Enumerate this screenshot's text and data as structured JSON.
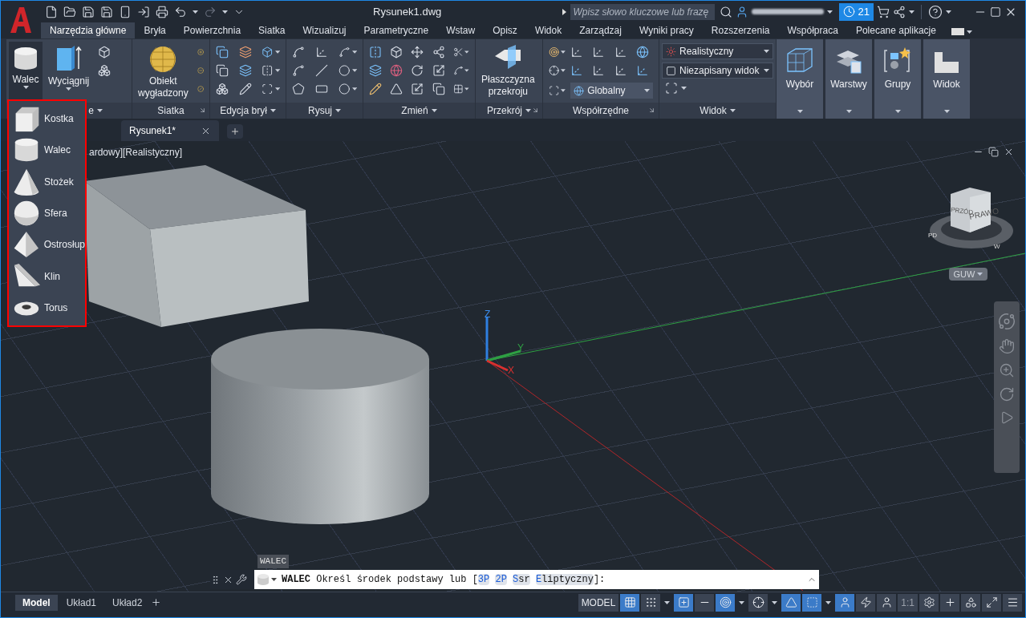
{
  "title_bar": {
    "document_title": "Rysunek1.dwg",
    "search_placeholder": "Wpisz słowo kluczowe lub frazę",
    "notifications": "21"
  },
  "ribbon_tabs": [
    {
      "label": "Narzędzia główne",
      "selected": true
    },
    {
      "label": "Bryła",
      "selected": false
    },
    {
      "label": "Powierzchnia",
      "selected": false
    },
    {
      "label": "Siatka",
      "selected": false
    },
    {
      "label": "Wizualizuj",
      "selected": false
    },
    {
      "label": "Parametryczne",
      "selected": false
    },
    {
      "label": "Wstaw",
      "selected": false
    },
    {
      "label": "Opisz",
      "selected": false
    },
    {
      "label": "Widok",
      "selected": false
    },
    {
      "label": "Zarządzaj",
      "selected": false
    },
    {
      "label": "Wyniki pracy",
      "selected": false
    },
    {
      "label": "Rozszerzenia",
      "selected": false
    },
    {
      "label": "Współpraca",
      "selected": false
    },
    {
      "label": "Polecane aplikacje",
      "selected": false
    }
  ],
  "ribbon_panels": [
    {
      "kind": "modeling",
      "title": "e",
      "menu": true,
      "launcher": false,
      "large": [
        {
          "label": "Walec",
          "menu": true,
          "pressed": true
        },
        {
          "label": "Wyciągnij",
          "menu": true,
          "pressed": false
        }
      ]
    },
    {
      "kind": "mesh",
      "title": "Siatka",
      "menu": false,
      "launcher": true,
      "large": [
        {
          "label": "Obiekt wygładzony",
          "menu": false,
          "pressed": false
        }
      ]
    },
    {
      "kind": "solid-edit",
      "title": "Edycja brył",
      "menu": true,
      "launcher": false
    },
    {
      "kind": "draw",
      "title": "Rysuj",
      "menu": true,
      "launcher": false
    },
    {
      "kind": "modify",
      "title": "Zmień",
      "menu": true,
      "launcher": false
    },
    {
      "kind": "section",
      "title": "Przekrój",
      "menu": true,
      "launcher": true,
      "large": [
        {
          "label": "Płaszczyzna przekroju",
          "menu": false,
          "pressed": false
        }
      ]
    },
    {
      "kind": "coords",
      "title": "Współrzędne",
      "menu": false,
      "launcher": true,
      "dropdowns": [
        "Globalny"
      ]
    },
    {
      "kind": "view",
      "title": "Widok",
      "menu": true,
      "launcher": false,
      "dropdowns": [
        "Realistyczny",
        "Niezapisany widok"
      ]
    },
    {
      "kind": "selection",
      "title": "Wybór",
      "menu": true,
      "launcher": false
    },
    {
      "kind": "layers",
      "title": "Warstwy",
      "menu": true,
      "launcher": false
    },
    {
      "kind": "groups",
      "title": "Grupy",
      "menu": true,
      "launcher": false
    },
    {
      "kind": "view-collapsed",
      "title": "Widok",
      "menu": true,
      "launcher": false
    }
  ],
  "file_tabs": [
    {
      "label": "Rysunek1*",
      "selected": true
    }
  ],
  "shape_menu": [
    {
      "kind": "box",
      "label": "Kostka"
    },
    {
      "kind": "cylinder",
      "label": "Walec"
    },
    {
      "kind": "cone",
      "label": "Stożek"
    },
    {
      "kind": "sphere",
      "label": "Sfera"
    },
    {
      "kind": "pyramid",
      "label": "Ostrosłup"
    },
    {
      "kind": "wedge",
      "label": "Klin"
    },
    {
      "kind": "torus",
      "label": "Torus"
    }
  ],
  "viewport": {
    "label": "ardowy][Realistyczny]",
    "ucs": {
      "x": "X",
      "y": "Y",
      "z": "Z"
    },
    "viewcube": {
      "front": "PRZÓD",
      "right": "PRAWO",
      "compass_left": "PD",
      "compass_right": "W"
    },
    "ucs_menu": "GUW"
  },
  "command_line": {
    "tooltip": "WALEC",
    "command": "WALEC",
    "prompt": "Określ środek podstawy lub [",
    "options": [
      {
        "key": "3P"
      },
      {
        "key": "2P"
      },
      {
        "key": "S",
        "rest": "sr"
      },
      {
        "key": "E",
        "rest": "liptyczny"
      }
    ],
    "suffix": "]:"
  },
  "layout_tabs": [
    {
      "label": "Model",
      "selected": true
    },
    {
      "label": "Układ1",
      "selected": false
    },
    {
      "label": "Układ2",
      "selected": false
    }
  ],
  "status_bar": [
    {
      "kind": "text",
      "label": "MODEL",
      "on": false
    },
    {
      "kind": "grid",
      "on": true
    },
    {
      "kind": "snap",
      "on": false
    },
    {
      "kind": "caret"
    },
    {
      "kind": "input",
      "on": true
    },
    {
      "kind": "ortho",
      "on": false
    },
    {
      "kind": "polar",
      "on": true
    },
    {
      "kind": "caret"
    },
    {
      "kind": "track",
      "on": false
    },
    {
      "kind": "caret"
    },
    {
      "kind": "angle",
      "on": true
    },
    {
      "kind": "selection",
      "on": true
    },
    {
      "kind": "caret"
    },
    {
      "kind": "annotation",
      "on": true
    },
    {
      "kind": "autoscale",
      "on": false
    },
    {
      "kind": "annovisible",
      "on": false
    },
    {
      "kind": "scale",
      "label": "1:1",
      "on": false
    },
    {
      "kind": "gear",
      "on": false
    },
    {
      "kind": "plus",
      "on": false
    },
    {
      "kind": "shapes",
      "on": false
    },
    {
      "kind": "fullscreen",
      "on": false
    },
    {
      "kind": "menu",
      "on": false
    }
  ]
}
